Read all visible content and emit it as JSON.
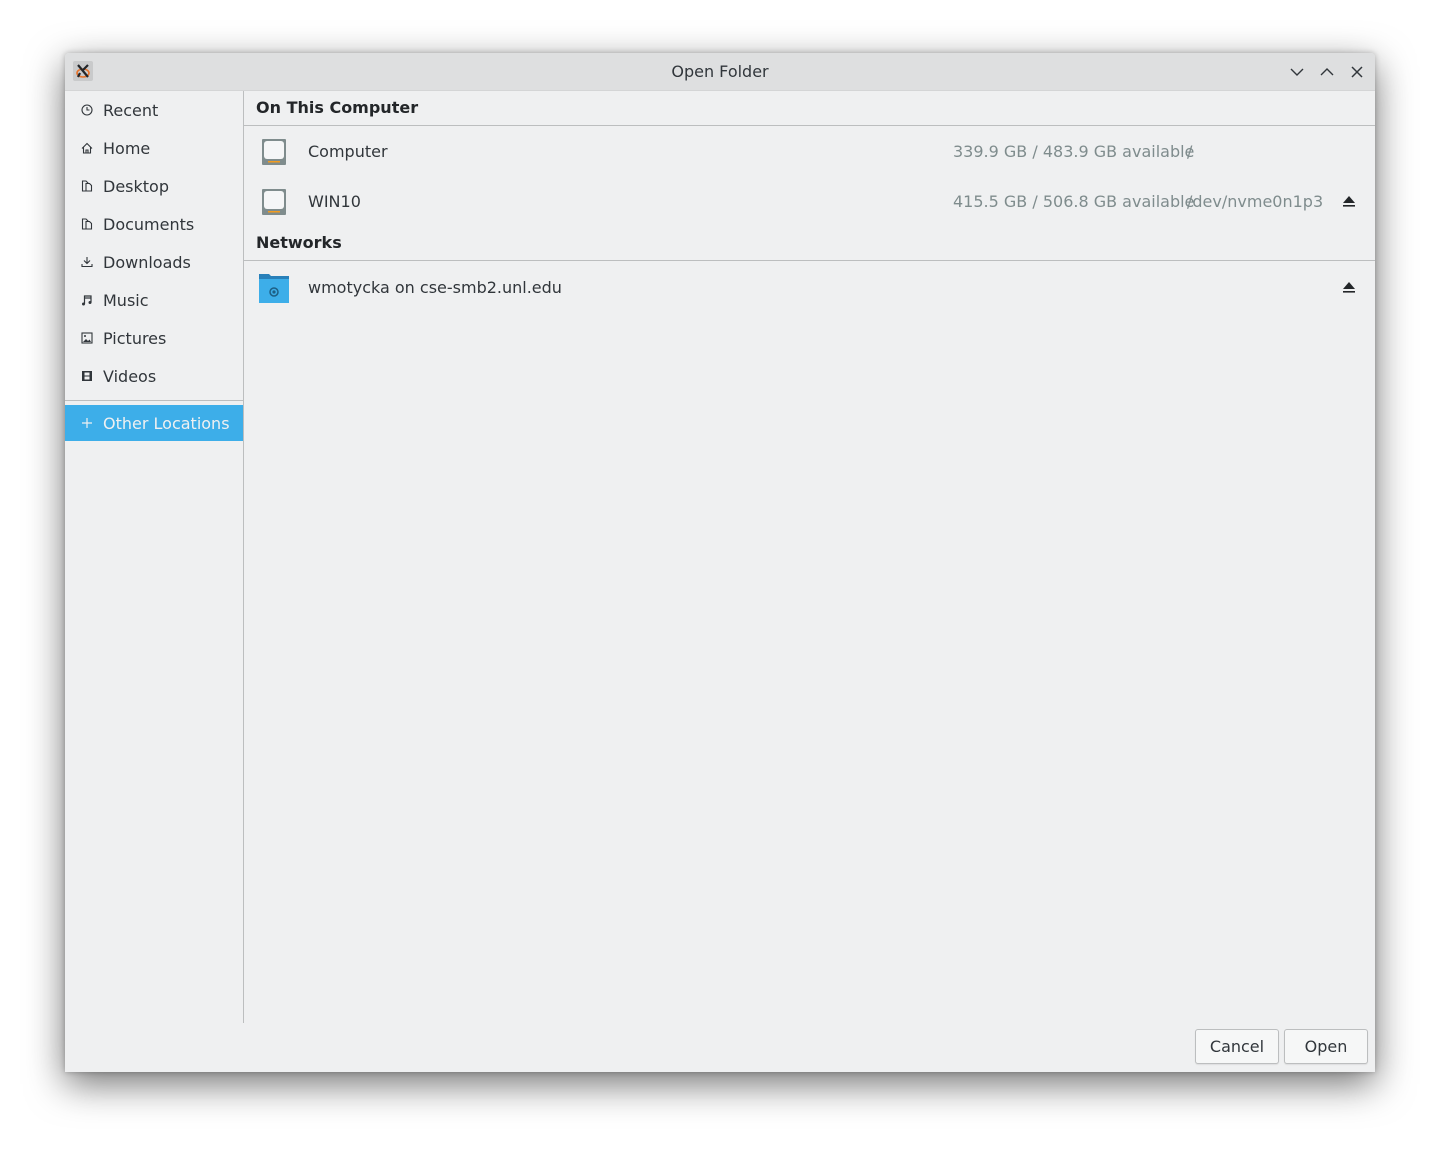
{
  "window": {
    "title": "Open Folder",
    "controls": [
      "minimize",
      "maximize",
      "close"
    ]
  },
  "sidebar": {
    "items": [
      {
        "label": "Recent",
        "icon": "clock-icon"
      },
      {
        "label": "Home",
        "icon": "home-icon"
      },
      {
        "label": "Desktop",
        "icon": "folder-icon"
      },
      {
        "label": "Documents",
        "icon": "folder-icon"
      },
      {
        "label": "Downloads",
        "icon": "download-icon"
      },
      {
        "label": "Music",
        "icon": "music-icon"
      },
      {
        "label": "Pictures",
        "icon": "picture-icon"
      },
      {
        "label": "Videos",
        "icon": "film-icon"
      }
    ],
    "other_locations": {
      "label": "Other Locations",
      "icon": "plus-icon",
      "active": true
    }
  },
  "main": {
    "sections": [
      {
        "header": "On This Computer",
        "rows": [
          {
            "name": "Computer",
            "available": "339.9 GB / 483.9 GB available",
            "path": "/",
            "eject": false,
            "icon": "harddisk-icon"
          },
          {
            "name": "WIN10",
            "available": "415.5 GB / 506.8 GB available",
            "path": "/dev/nvme0n1p3",
            "eject": true,
            "icon": "harddisk-icon"
          }
        ]
      },
      {
        "header": "Networks",
        "rows": [
          {
            "name": "wmotycka on cse-smb2.unl.edu",
            "available": "",
            "path": "",
            "eject": true,
            "icon": "network-folder-icon"
          }
        ]
      }
    ]
  },
  "footer": {
    "cancel_label": "Cancel",
    "open_label": "Open"
  },
  "colors": {
    "accent": "#3daee9",
    "window_bg": "#eff0f1",
    "titlebar_bg": "#dedfe0",
    "text": "#31363b",
    "secondary_text": "#7f8c8d"
  }
}
